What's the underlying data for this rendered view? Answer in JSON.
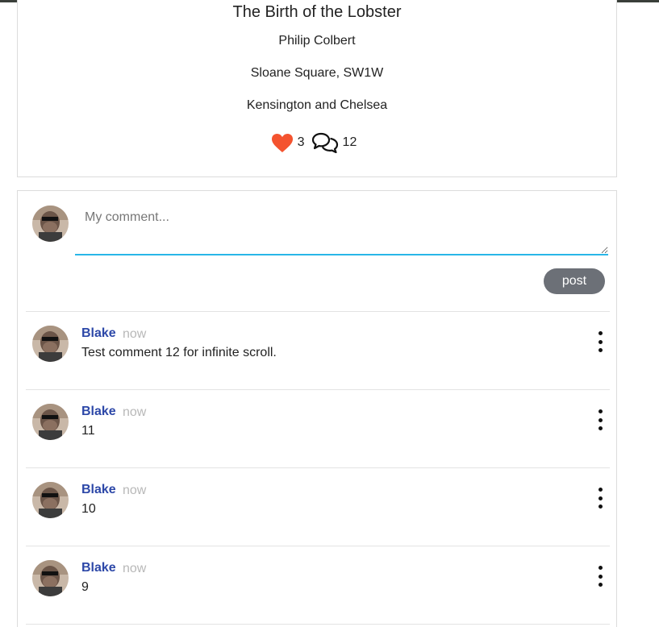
{
  "artwork": {
    "title": "The Birth of the Lobster",
    "artist": "Philip Colbert",
    "address": "Sloane Square, SW1W",
    "borough": "Kensington and Chelsea",
    "likes": "3",
    "comments_count": "12",
    "like_color": "#f4532f"
  },
  "composer": {
    "placeholder": "My comment...",
    "post_label": "post",
    "focus_color": "#29b6e8"
  },
  "comments": [
    {
      "author": "Blake",
      "time": "now",
      "text": "Test comment 12 for infinite scroll."
    },
    {
      "author": "Blake",
      "time": "now",
      "text": "11"
    },
    {
      "author": "Blake",
      "time": "now",
      "text": "10"
    },
    {
      "author": "Blake",
      "time": "now",
      "text": "9"
    }
  ],
  "colors": {
    "author": "#2d48a8",
    "timestamp": "#b8b8b8",
    "button": "#6c7077"
  }
}
